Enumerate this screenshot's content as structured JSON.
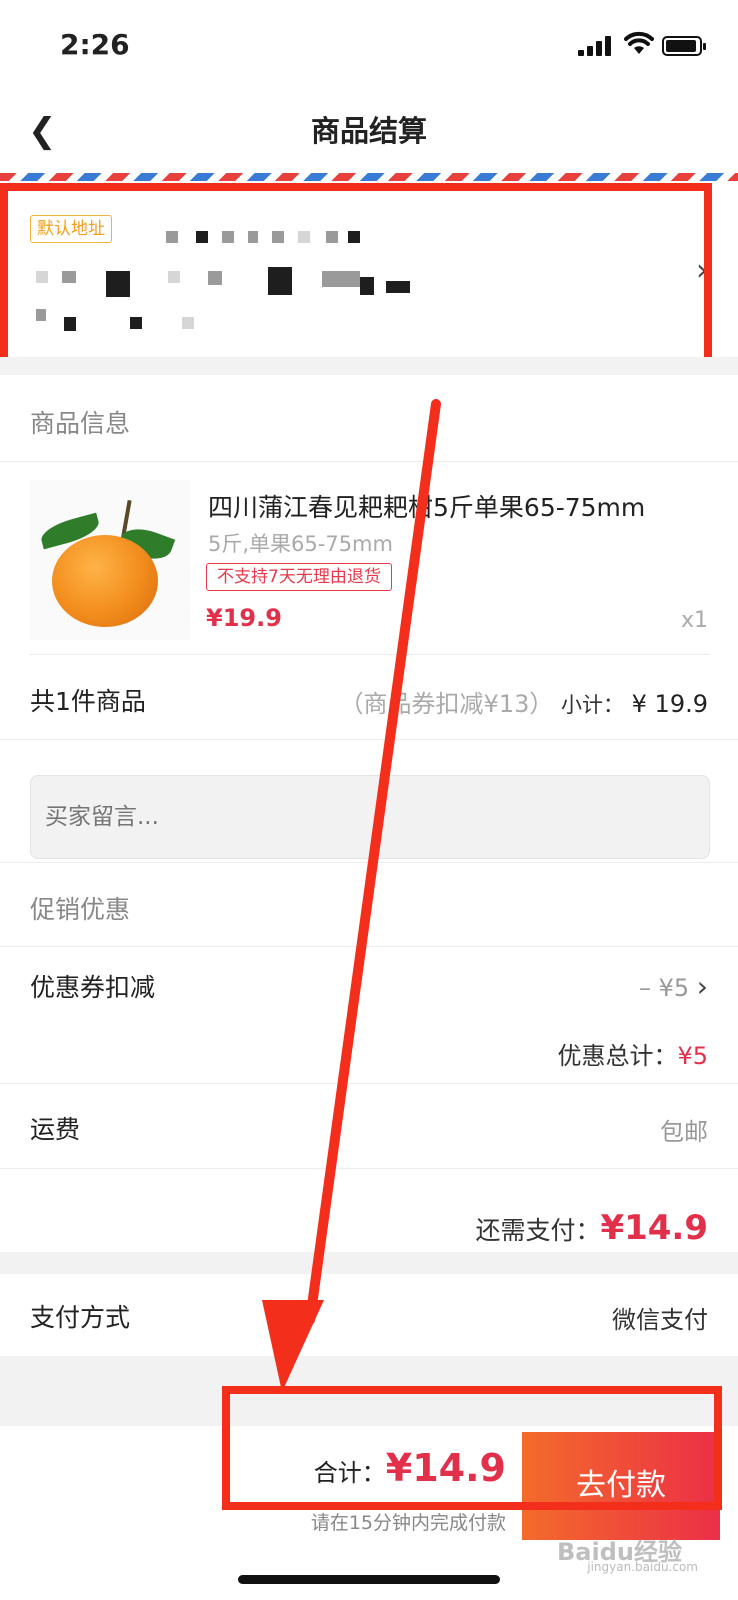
{
  "status_bar": {
    "time": "2:26"
  },
  "nav": {
    "back_icon": "chevron-left-icon",
    "title": "商品结算"
  },
  "address": {
    "tag": "默认地址"
  },
  "product_section": {
    "title": "商品信息",
    "item": {
      "name": "四川蒲江春见耙耙柑5斤单果65-75mm",
      "spec": "5斤,单果65-75mm",
      "tag": "不支持7天无理由退货",
      "price": "¥19.9",
      "qty": "x1"
    },
    "count_label": "共1件商品",
    "coupon_note": "（商品券扣减¥13）",
    "subtotal_label": "小计：",
    "subtotal_value": "¥ 19.9"
  },
  "memo": {
    "placeholder": "买家留言..."
  },
  "promo": {
    "title": "促销优惠",
    "coupon_label": "优惠券扣减",
    "coupon_value": "– ¥5",
    "total_label": "优惠总计：",
    "total_value": "¥5"
  },
  "shipping": {
    "label": "运费",
    "value": "包邮"
  },
  "remaining": {
    "label": "还需支付：",
    "value": "¥14.9"
  },
  "payment_method": {
    "label": "支付方式",
    "value": "微信支付"
  },
  "bottom_bar": {
    "total_label": "合计：",
    "total_value": "¥14.9",
    "hint": "请在15分钟内完成付款",
    "pay_button": "去付款"
  },
  "watermark": {
    "brand": "Baidu经验",
    "url": "jingyan.baidu.com"
  },
  "colors": {
    "accent_red": "#e3304a",
    "annotation_red": "#f32f1c",
    "tag_orange": "#f0a020"
  }
}
